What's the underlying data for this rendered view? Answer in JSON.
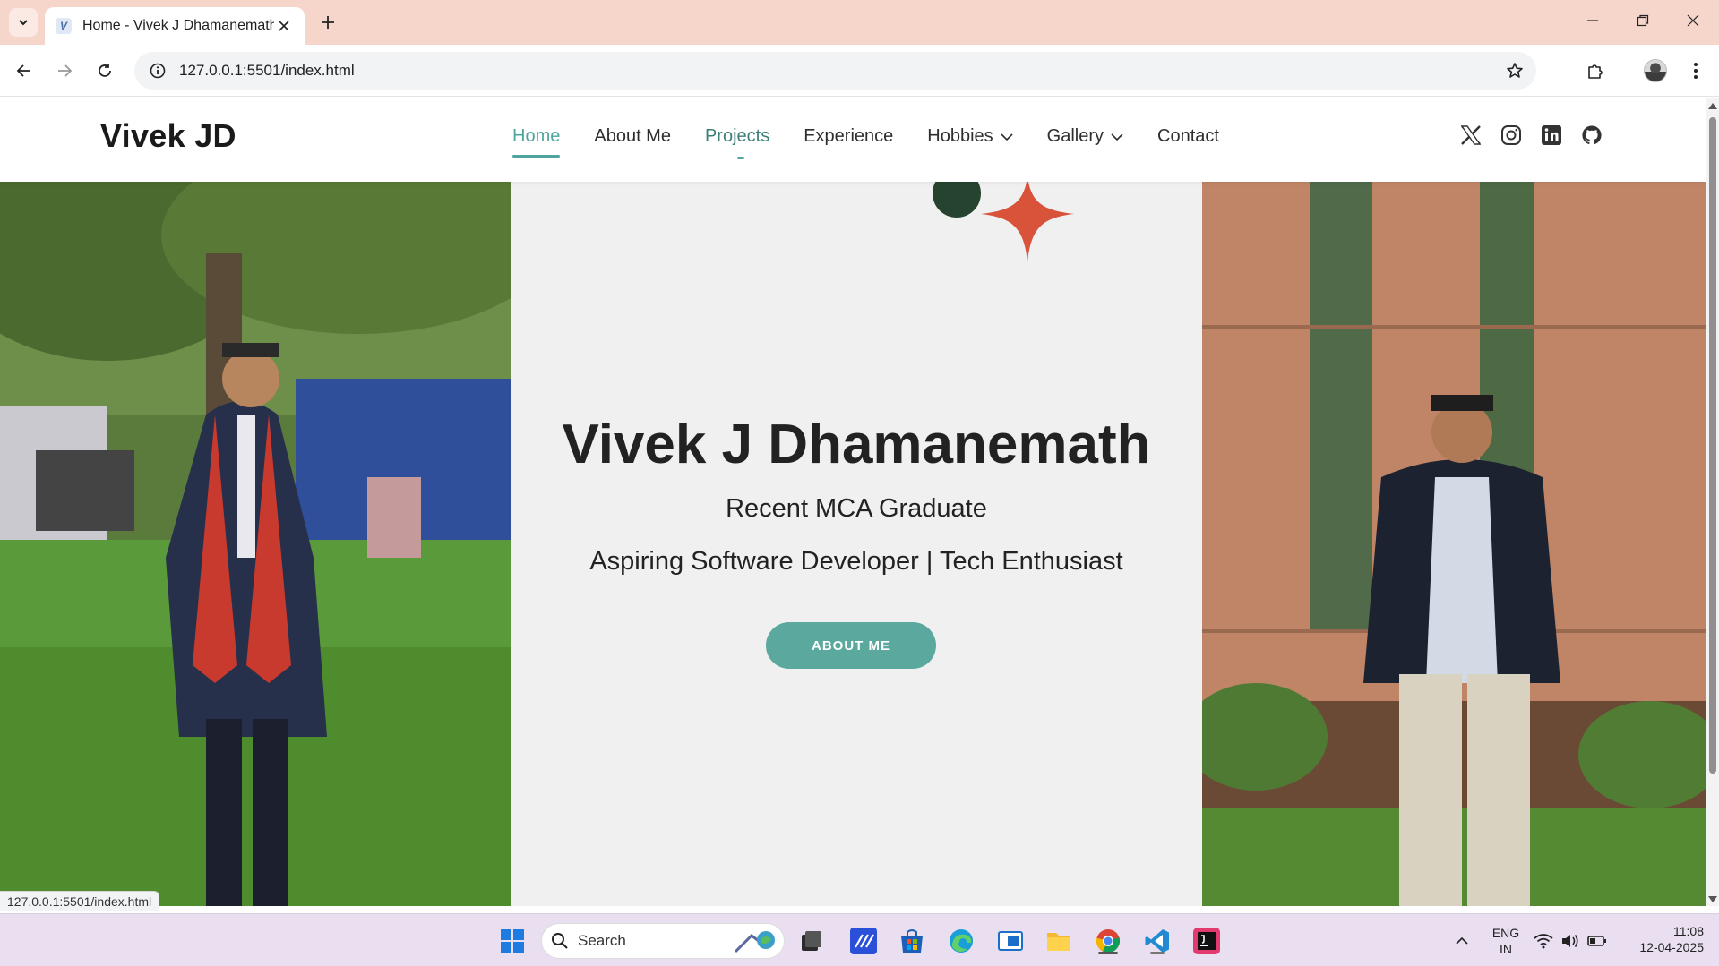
{
  "browser": {
    "tab_title": "Home - Vivek J Dhamanemath",
    "url": "127.0.0.1:5501/index.html",
    "status_url": "127.0.0.1:5501/index.html"
  },
  "site": {
    "logo": "Vivek JD",
    "nav": {
      "home": "Home",
      "about": "About Me",
      "projects": "Projects",
      "experience": "Experience",
      "hobbies": "Hobbies",
      "gallery": "Gallery",
      "contact": "Contact"
    },
    "socials": [
      "x-icon",
      "instagram-icon",
      "linkedin-icon",
      "github-icon"
    ],
    "hero": {
      "name": "Vivek J Dhamanemath",
      "subtitle1": "Recent MCA Graduate",
      "subtitle2": "Aspiring Software Developer | Tech Enthusiast",
      "button": "ABOUT ME"
    },
    "accent_color": "#5aa89e"
  },
  "taskbar": {
    "search_label": "Search",
    "lang_line1": "ENG",
    "lang_line2": "IN",
    "time": "11:08",
    "date": "12-04-2025"
  }
}
